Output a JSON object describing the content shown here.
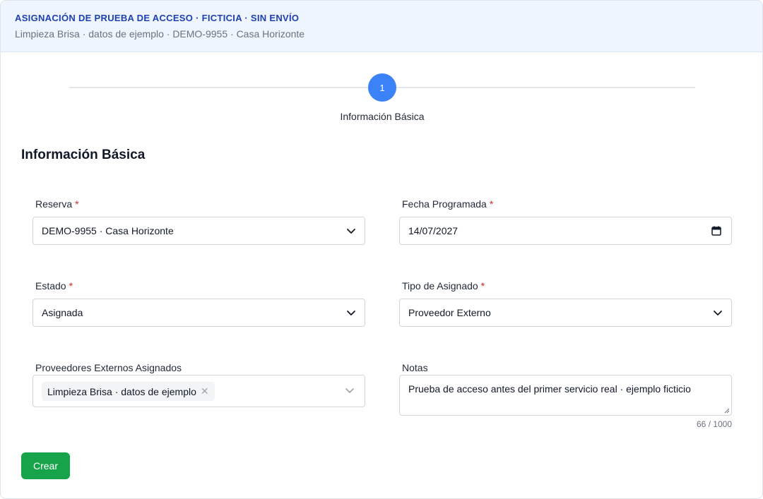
{
  "banner": {
    "title": "ASIGNACIÓN DE PRUEBA DE ACCESO · FICTICIA · SIN ENVÍO",
    "subtitle": "Limpieza Brisa · datos de ejemplo · DEMO-9955 · Casa Horizonte"
  },
  "stepper": {
    "steps": [
      {
        "number": "1",
        "label": "Información Básica"
      }
    ]
  },
  "section": {
    "title": "Información Básica"
  },
  "form": {
    "required_mark": "*",
    "reserva": {
      "label": "Reserva",
      "value": "DEMO-9955 · Casa Horizonte"
    },
    "fecha": {
      "label": "Fecha Programada",
      "value": "14/07/2027"
    },
    "estado": {
      "label": "Estado",
      "value": "Asignada"
    },
    "tipo": {
      "label": "Tipo de Asignado",
      "value": "Proveedor Externo"
    },
    "proveedores": {
      "label": "Proveedores Externos Asignados",
      "tags": [
        "Limpieza Brisa · datos de ejemplo"
      ],
      "remove_glyph": "✕"
    },
    "notas": {
      "label": "Notas",
      "value": "Prueba de acceso antes del primer servicio real · ejemplo ficticio",
      "counter": "66 / 1000"
    },
    "submit_label": "Crear"
  },
  "colors": {
    "accent": "#3b82f6",
    "banner_bg": "#eef5ff",
    "banner_title": "#1e40af",
    "required": "#dc2626",
    "submit": "#16a34a"
  }
}
